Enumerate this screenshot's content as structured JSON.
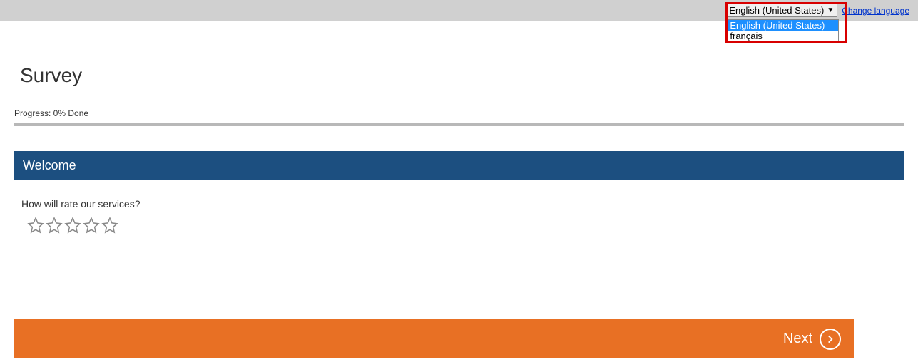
{
  "header": {
    "language_selected": "English (United States)",
    "language_options": [
      "English (United States)",
      "français"
    ],
    "change_language_label": "Change language"
  },
  "survey": {
    "title": "Survey",
    "progress_label": "Progress: 0% Done",
    "section_title": "Welcome",
    "question_text": "How will rate our services?",
    "star_count": 5
  },
  "footer": {
    "next_label": "Next"
  },
  "colors": {
    "section_bg": "#1c4f80",
    "next_bg": "#e87024",
    "highlight_border": "#d80000"
  }
}
